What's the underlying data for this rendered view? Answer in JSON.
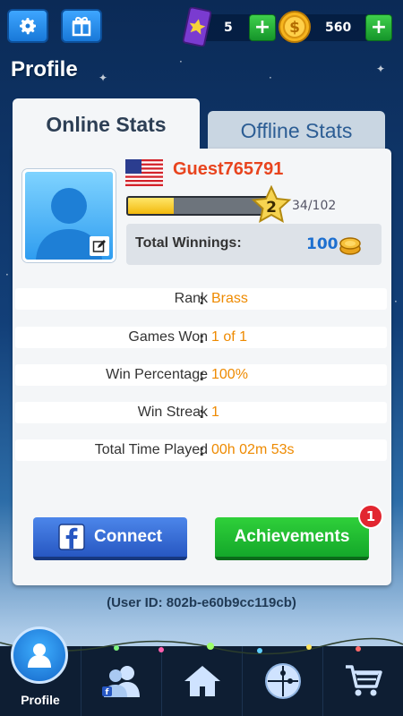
{
  "topbar": {
    "tickets": "5",
    "coins": "560",
    "plus_label": "+"
  },
  "page": {
    "title": "Profile"
  },
  "tabs": [
    {
      "label": "Online Stats",
      "active": true
    },
    {
      "label": "Offline Stats",
      "active": false
    }
  ],
  "profile": {
    "username": "Guest765791",
    "level": "2",
    "xp_text": "34/102",
    "xp_progress": 0.33,
    "total_winnings_label": "Total Winnings:",
    "total_winnings_value": "100"
  },
  "stats": [
    {
      "label": "Rank",
      "value": "Brass"
    },
    {
      "label": "Games Won",
      "value": "1 of 1"
    },
    {
      "label": "Win Percentage",
      "value": "100%"
    },
    {
      "label": "Win Streak",
      "value": "1"
    },
    {
      "label": "Total Time Played",
      "value": "00h 02m 53s"
    }
  ],
  "stats_separator": ":",
  "buttons": {
    "connect": "Connect",
    "achievements": "Achievements",
    "achievements_badge": "1"
  },
  "user_id": "(User ID: 802b-e60b9cc119cb)",
  "nav": {
    "profile": "Profile",
    "items": [
      "profile-icon",
      "friends-icon",
      "home-icon",
      "puzzle-icon",
      "cart-icon"
    ]
  },
  "colors": {
    "username": "#e8441e",
    "stat_value": "#ee8a00",
    "winnings_value": "#1d6fcf",
    "facebook": "#2757c2",
    "achievements": "#14a82a"
  }
}
